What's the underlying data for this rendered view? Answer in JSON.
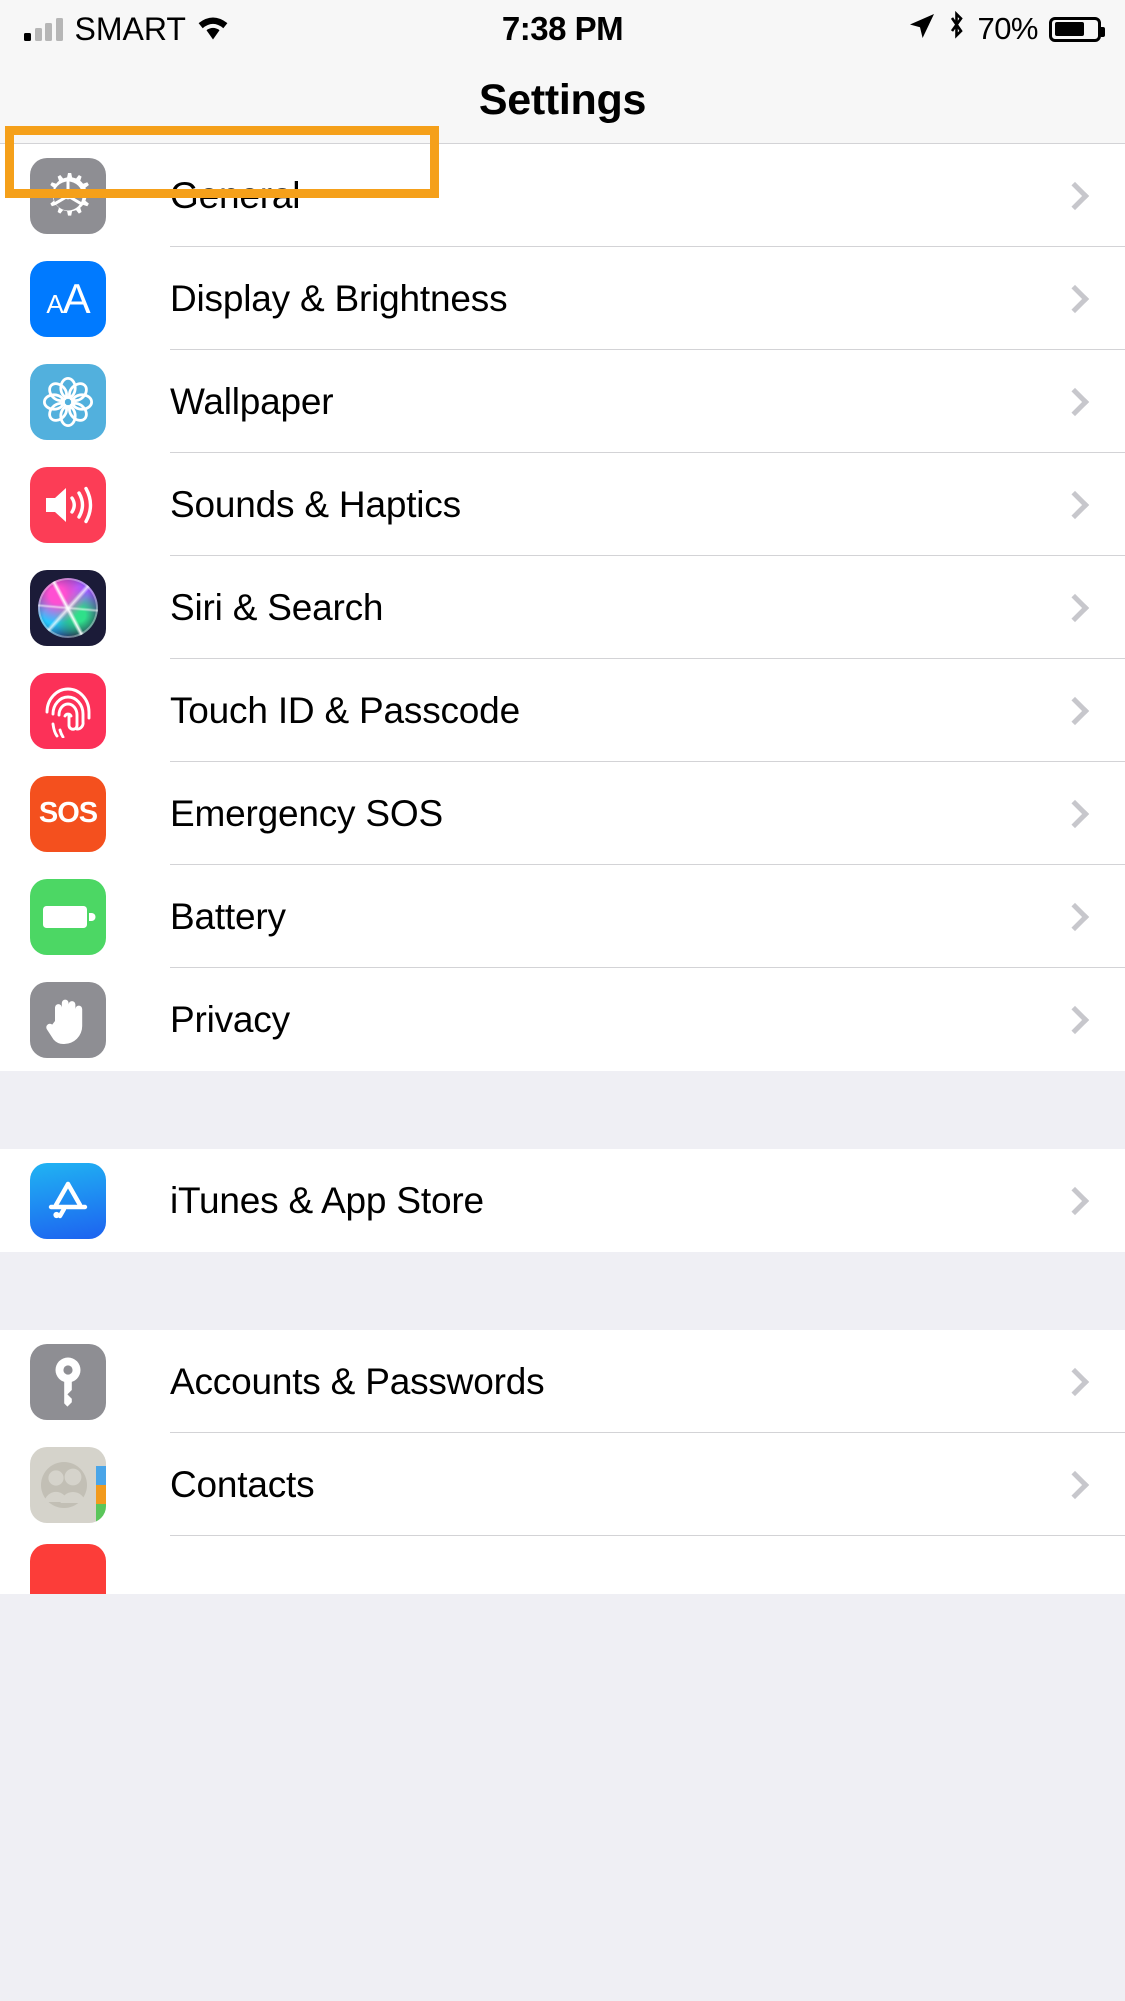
{
  "status_bar": {
    "carrier": "SMART",
    "wifi_icon": "wifi-icon",
    "signal_icon": "signal-bars-icon",
    "time": "7:38 PM",
    "location_icon": "location-arrow-icon",
    "bluetooth_icon": "bluetooth-icon",
    "battery_percent": "70%",
    "battery_icon": "battery-icon"
  },
  "navbar": {
    "title": "Settings"
  },
  "highlight": {
    "color": "#f5a01a",
    "target": "General"
  },
  "sections": [
    {
      "rows": [
        {
          "label": "General",
          "icon": "gear-icon",
          "chevron": "chevron-right-icon",
          "highlighted": true
        },
        {
          "label": "Display & Brightness",
          "icon": "aa-text-icon",
          "chevron": "chevron-right-icon"
        },
        {
          "label": "Wallpaper",
          "icon": "flower-icon",
          "chevron": "chevron-right-icon"
        },
        {
          "label": "Sounds & Haptics",
          "icon": "speaker-icon",
          "chevron": "chevron-right-icon"
        },
        {
          "label": "Siri & Search",
          "icon": "siri-orb-icon",
          "chevron": "chevron-right-icon"
        },
        {
          "label": "Touch ID & Passcode",
          "icon": "fingerprint-icon",
          "chevron": "chevron-right-icon"
        },
        {
          "label": "Emergency SOS",
          "icon": "sos-icon",
          "chevron": "chevron-right-icon"
        },
        {
          "label": "Battery",
          "icon": "battery-icon",
          "chevron": "chevron-right-icon"
        },
        {
          "label": "Privacy",
          "icon": "hand-icon",
          "chevron": "chevron-right-icon"
        }
      ]
    },
    {
      "rows": [
        {
          "label": "iTunes & App Store",
          "icon": "app-store-icon",
          "chevron": "chevron-right-icon"
        }
      ]
    },
    {
      "rows": [
        {
          "label": "Accounts & Passwords",
          "icon": "key-icon",
          "chevron": "chevron-right-icon"
        },
        {
          "label": "Contacts",
          "icon": "contacts-icon",
          "chevron": "chevron-right-icon"
        }
      ]
    }
  ],
  "colors": {
    "accent_highlight": "#f5a01a",
    "gray_icon": "#8e8e93",
    "blue": "#007aff",
    "wallpaper_blue": "#52b0dd",
    "red": "#fc3d56",
    "pink": "#fc3158",
    "orange": "#f4501e",
    "green": "#4cd764",
    "list_bg": "#ffffff",
    "group_bg": "#efeff4"
  }
}
